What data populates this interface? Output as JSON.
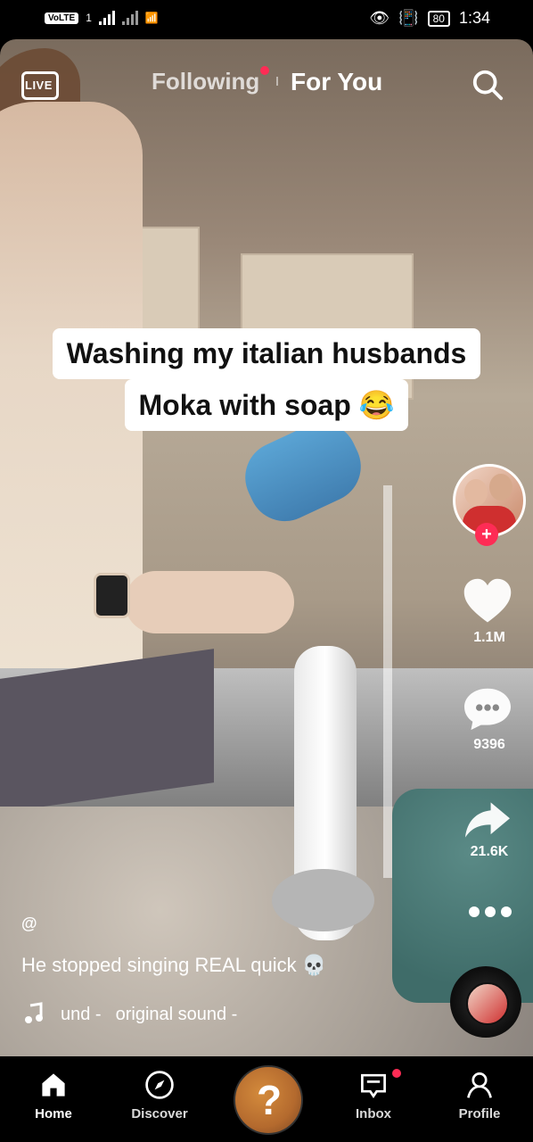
{
  "status_bar": {
    "volte_label": "VoLTE",
    "sim_label": "1",
    "battery": "80",
    "time": "1:34"
  },
  "top_nav": {
    "live_label": "LIVE",
    "following_label": "Following",
    "for_you_label": "For You"
  },
  "video": {
    "caption_line1": "Washing my italian husbands",
    "caption_line2": "Moka with soap 😂"
  },
  "right_actions": {
    "likes": "1.1M",
    "comments": "9396",
    "shares": "21.6K"
  },
  "post": {
    "author_prefix": "@",
    "description": "He stopped singing REAL quick 💀",
    "sound_left": "und -",
    "sound_right": "original sound -"
  },
  "bottom_nav": {
    "home": "Home",
    "discover": "Discover",
    "inbox": "Inbox",
    "profile": "Profile",
    "create_label": "?"
  },
  "colors": {
    "accent": "#fe2c55"
  },
  "icons": {
    "live": "live-icon",
    "search": "search-icon",
    "like": "heart-icon",
    "comment": "comment-icon",
    "share": "share-icon",
    "more": "more-icon",
    "music": "music-note-icon",
    "home": "home-icon",
    "discover": "compass-icon",
    "inbox": "inbox-icon",
    "profile": "profile-icon"
  }
}
